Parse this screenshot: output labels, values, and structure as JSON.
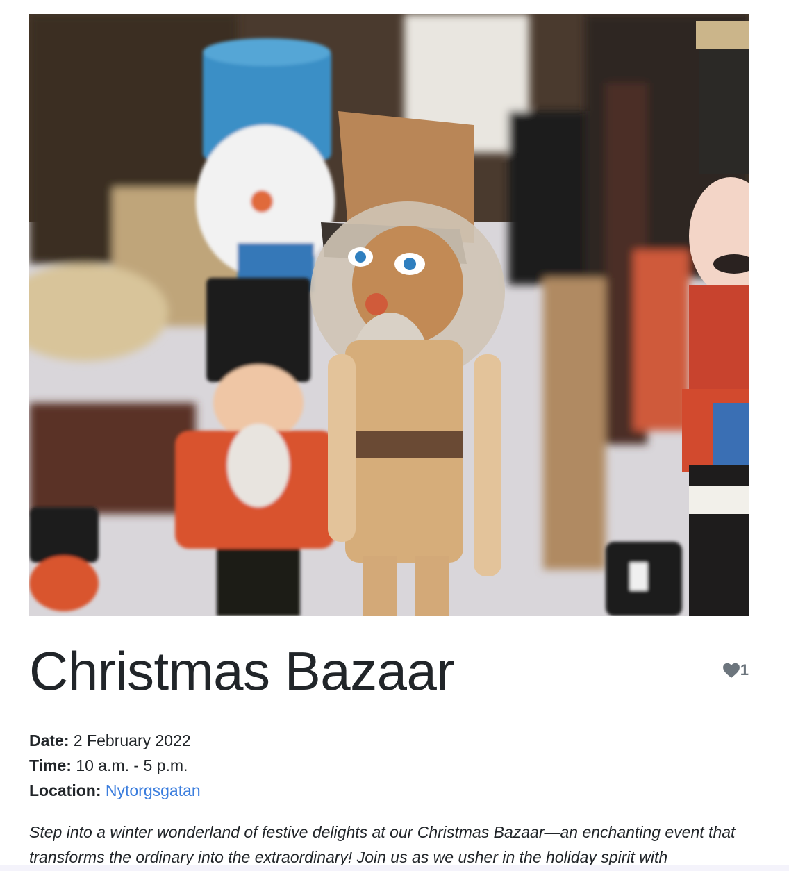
{
  "event": {
    "title": "Christmas Bazaar",
    "like_count": "1",
    "details": {
      "date_label": "Date:",
      "date_value": "2 February 2022",
      "time_label": "Time:",
      "time_value": "10 a.m. - 5 p.m.",
      "location_label": "Location:",
      "location_value": "Nytorgsgatan"
    },
    "description": "Step into a winter wonderland of festive delights at our Christmas Bazaar—an enchanting event that transforms the ordinary into the extraordinary! Join us as we usher in the holiday spirit with"
  },
  "icons": {
    "like": "heart-icon"
  },
  "colors": {
    "link": "#3b7ddd",
    "muted": "#6c757d",
    "text": "#212529"
  }
}
